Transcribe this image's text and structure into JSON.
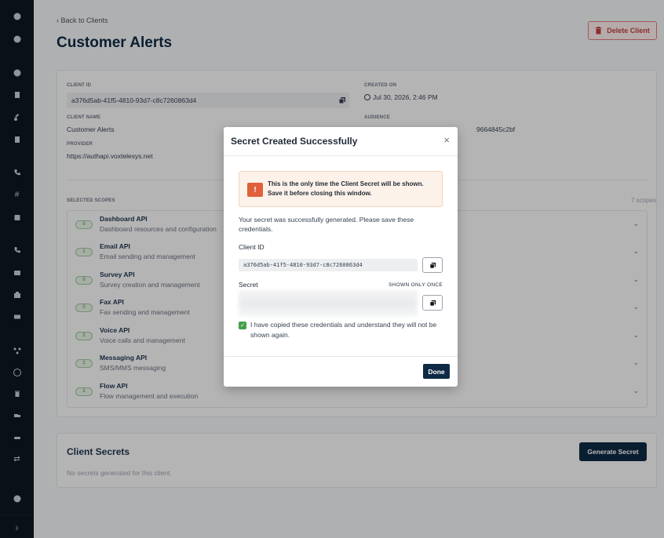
{
  "colors": {
    "sidebar": "#0f1720",
    "primary": "#0f2a44",
    "danger": "#c24040",
    "warning_icon": "#e0603b",
    "success": "#43a047"
  },
  "sidebar": {
    "icons": [
      "help-circle-icon",
      "user-circle-icon",
      "clock-icon",
      "document-icon",
      "key-icon",
      "file-icon",
      "phone-icon",
      "hash-icon",
      "lock-box-icon",
      "phone-2-icon",
      "chat-icon",
      "fax-icon",
      "mail-icon",
      "flow-icon",
      "inbox-icon",
      "trash-icon",
      "truck-icon",
      "handshake-icon",
      "swap-icon",
      "help-icon"
    ],
    "expand": "›"
  },
  "header": {
    "back": "‹  Back to Clients",
    "title": "Customer Alerts",
    "delete": "Delete Client"
  },
  "details": {
    "client_id_label": "CLIENT ID",
    "client_id": "a376d5ab-41f5-4810-93d7-c8c7260863d4",
    "created_label": "CREATED ON",
    "created": "Jul 30, 2026, 2:46 PM",
    "name_label": "CLIENT NAME",
    "name": "Customer Alerts",
    "audience_label": "AUDIENCE",
    "audience_partial": "9664845c2bf",
    "provider_label": "PROVIDER",
    "provider": "https://authapi.voxtelesys.net",
    "scopes_label": "SELECTED SCOPES",
    "scopes_count": "7 scopes"
  },
  "scopes": [
    {
      "count": "0",
      "name": "Dashboard API",
      "desc": "Dashboard resources and configuration"
    },
    {
      "count": "1",
      "name": "Email API",
      "desc": "Email sending and management"
    },
    {
      "count": "0",
      "name": "Survey API",
      "desc": "Survey creation and management"
    },
    {
      "count": "0",
      "name": "Fax API",
      "desc": "Fax sending and management"
    },
    {
      "count": "2",
      "name": "Voice API",
      "desc": "Voice calls and management"
    },
    {
      "count": "2",
      "name": "Messaging API",
      "desc": "SMS/MMS messaging"
    },
    {
      "count": "2",
      "name": "Flow API",
      "desc": "Flow management and execution"
    }
  ],
  "secrets": {
    "title": "Client Secrets",
    "empty": "No secrets generated for this client.",
    "generate": "Generate Secret"
  },
  "modal": {
    "title": "Secret Created Successfully",
    "close": "×",
    "warning": "This is the only time the Client Secret will be shown. Save it before closing this window.",
    "intro": "Your secret was successfully generated. Please save these credentials.",
    "client_id_label": "Client ID",
    "client_id": "a376d5ab-41f5-4810-93d7-c8c7260863d4",
    "secret_label": "Secret",
    "shown_once": "SHOWN ONLY ONCE",
    "confirm": "I have copied these credentials and understand they will not be shown again.",
    "done": "Done"
  }
}
